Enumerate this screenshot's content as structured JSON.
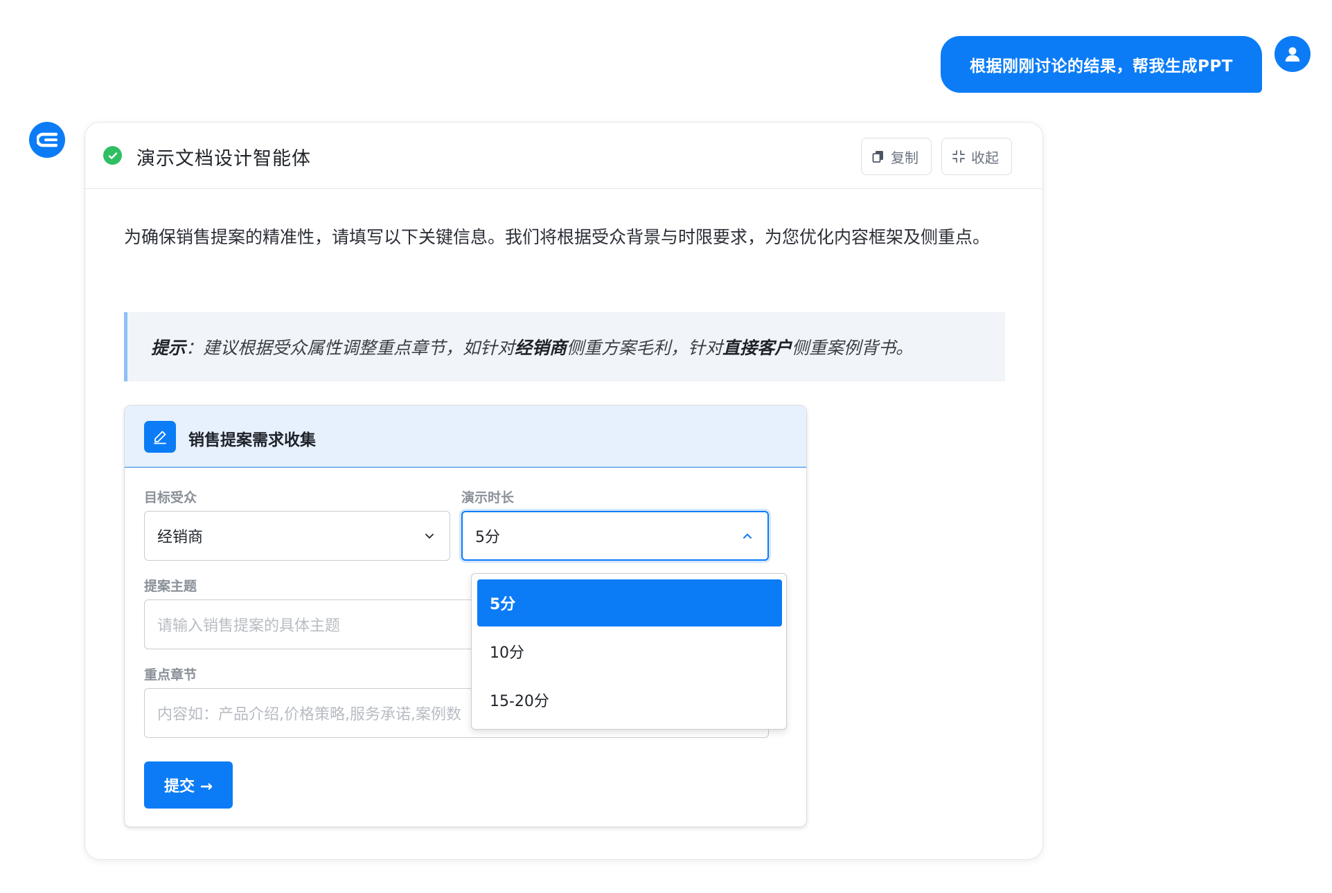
{
  "user_message": {
    "text": "根据刚刚讨论的结果，帮我生成PPT"
  },
  "agent": {
    "title": "演示文档设计智能体",
    "status": "completed",
    "buttons": {
      "copy_label": "复制",
      "collapse_label": "收起"
    },
    "intro": "为确保销售提案的精准性，请填写以下关键信息。我们将根据受众背景与时限要求，为您优化内容框架及侧重点。",
    "hint": {
      "label": "提示",
      "sep": "：",
      "part1": "建议根据受众属性调整重点章节，如针对",
      "bold1": "经销商",
      "part2": "侧重方案毛利，针对",
      "bold2": "直接客户",
      "part3": "侧重案例背书。"
    }
  },
  "form": {
    "title": "销售提案需求收集",
    "fields": {
      "audience": {
        "label": "目标受众",
        "value": "经销商"
      },
      "duration": {
        "label": "演示时长",
        "value": "5分"
      },
      "topic": {
        "label": "提案主题",
        "placeholder": "请输入销售提案的具体主题"
      },
      "chapters": {
        "label": "重点章节",
        "placeholder": "内容如：产品介绍,价格策略,服务承诺,案例数"
      }
    },
    "submit_label": "提交 →",
    "duration_options": [
      "5分",
      "10分",
      "15-20分"
    ],
    "duration_selected_index": 0
  },
  "colors": {
    "accent": "#0b7cf6",
    "success": "#2fbf62",
    "hint_border": "#8ec0f5",
    "form_header_bg": "#e7f1fd"
  }
}
